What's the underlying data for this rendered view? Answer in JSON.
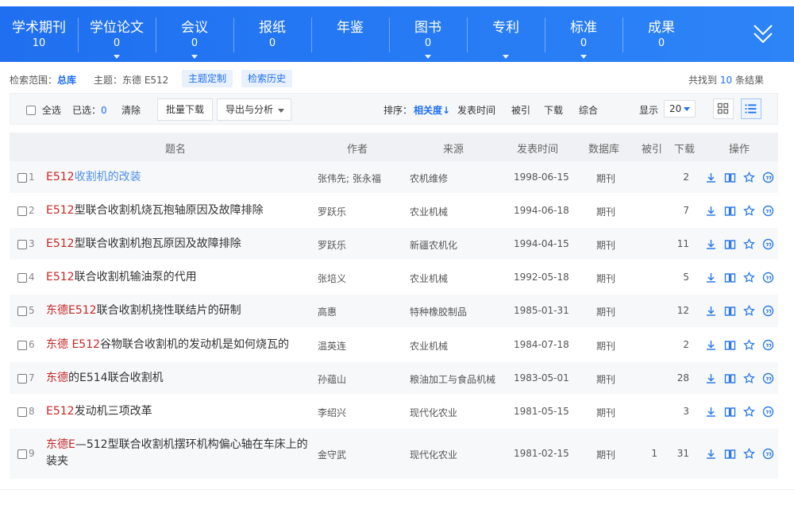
{
  "colors": {
    "accent": "#1f6ff0",
    "highlight": "#c62828",
    "link": "#4f8fe8"
  },
  "categories": [
    {
      "name": "学术期刊",
      "count": "10",
      "caret": false
    },
    {
      "name": "学位论文",
      "count": "0",
      "caret": true
    },
    {
      "name": "会议",
      "count": "0",
      "caret": true
    },
    {
      "name": "报纸",
      "count": "0",
      "caret": false
    },
    {
      "name": "年鉴",
      "count": "",
      "caret": false
    },
    {
      "name": "图书",
      "count": "0",
      "caret": true
    },
    {
      "name": "专利",
      "count": "",
      "caret": true
    },
    {
      "name": "标准",
      "count": "0",
      "caret": true
    },
    {
      "name": "成果",
      "count": "0",
      "caret": false
    }
  ],
  "scope": {
    "range_label": "检索范围：",
    "range_value": "总库",
    "topic_label": "主题：东德 E512",
    "custom_btn": "主题定制",
    "history_btn": "检索历史",
    "total_prefix": "共找到",
    "total_count": "10",
    "total_suffix": "条结果"
  },
  "toolbar": {
    "select_all": "全选",
    "selected_label": "已选：",
    "selected_count": "0",
    "clear": "清除",
    "batch_download": "批量下载",
    "export": "导出与分析",
    "sort_label": "排序：",
    "sort_relevance": "相关度",
    "sort_date": "发表时间",
    "sort_cited": "被引",
    "sort_download": "下载",
    "sort_overall": "综合",
    "display_label": "显示",
    "page_size": "20"
  },
  "columns": {
    "title": "题名",
    "author": "作者",
    "source": "来源",
    "date": "发表时间",
    "db": "数据库",
    "cited": "被引",
    "download": "下载",
    "ops": "操作"
  },
  "rows": [
    {
      "idx": "1",
      "hl": "E512",
      "rest": "收割机的改装",
      "link": true,
      "author": "张伟先; 张永福",
      "source": "农机维修",
      "date": "1998-06-15",
      "db": "期刊",
      "cited": "",
      "download": "2"
    },
    {
      "idx": "2",
      "hl": "E512",
      "rest": "型联合收割机烧瓦抱轴原因及故障排除",
      "link": false,
      "author": "罗跃乐",
      "source": "农业机械",
      "date": "1994-06-18",
      "db": "期刊",
      "cited": "",
      "download": "7"
    },
    {
      "idx": "3",
      "hl": "E512",
      "rest": "型联合收割机抱瓦原因及故障排除",
      "link": false,
      "author": "罗跃乐",
      "source": "新疆农机化",
      "date": "1994-04-15",
      "db": "期刊",
      "cited": "",
      "download": "11"
    },
    {
      "idx": "4",
      "hl": "E512",
      "rest": "联合收割机输油泵的代用",
      "link": false,
      "author": "张培义",
      "source": "农业机械",
      "date": "1992-05-18",
      "db": "期刊",
      "cited": "",
      "download": "5"
    },
    {
      "idx": "5",
      "hl": "东德E512",
      "rest": "联合收割机挠性联结片的研制",
      "link": false,
      "author": "高惠",
      "source": "特种橡胶制品",
      "date": "1985-01-31",
      "db": "期刊",
      "cited": "",
      "download": "12"
    },
    {
      "idx": "6",
      "hl": "东德 E512",
      "rest": "谷物联合收割机的发动机是如何烧瓦的",
      "link": false,
      "author": "温英连",
      "source": "农业机械",
      "date": "1984-07-18",
      "db": "期刊",
      "cited": "",
      "download": "2"
    },
    {
      "idx": "7",
      "hl": "东德",
      "rest": "的E514联合收割机",
      "link": false,
      "author": "孙蕴山",
      "source": "粮油加工与食品机械",
      "date": "1983-05-01",
      "db": "期刊",
      "cited": "",
      "download": "28"
    },
    {
      "idx": "8",
      "hl": "E512",
      "rest": "发动机三项改革",
      "link": false,
      "author": "李绍兴",
      "source": "现代化农业",
      "date": "1981-05-15",
      "db": "期刊",
      "cited": "",
      "download": "3"
    },
    {
      "idx": "9",
      "hl": "东德E",
      "rest": "—512型联合收割机摆环机构偏心轴在车床上的装夹",
      "link": false,
      "author": "金守武",
      "source": "现代化农业",
      "date": "1981-02-15",
      "db": "期刊",
      "cited": "1",
      "download": "31"
    }
  ]
}
